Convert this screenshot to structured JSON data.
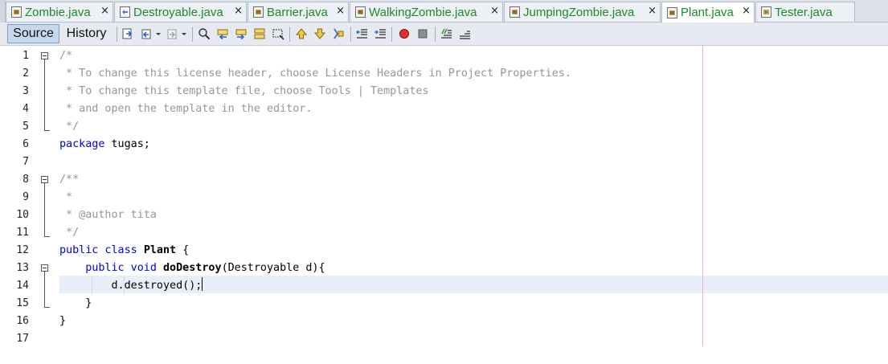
{
  "tabs": [
    {
      "label": "Zombie.java",
      "active": false
    },
    {
      "label": "Destroyable.java",
      "active": false
    },
    {
      "label": "Barrier.java",
      "active": false
    },
    {
      "label": "WalkingZombie.java",
      "active": false
    },
    {
      "label": "JumpingZombie.java",
      "active": false
    },
    {
      "label": "Plant.java",
      "active": true
    },
    {
      "label": "Tester.java",
      "active": false
    }
  ],
  "close_glyph": "×",
  "toolbar": {
    "source_label": "Source",
    "history_label": "History",
    "icons": [
      "last-edit-icon",
      "back-icon",
      "forward-icon",
      "find-icon",
      "find-previous-icon",
      "find-next-icon",
      "toggle-highlight-icon",
      "find-selection-icon",
      "previous-bookmark-icon",
      "next-bookmark-icon",
      "toggle-bookmark-icon",
      "shift-left-icon",
      "shift-right-icon",
      "start-macro-icon",
      "stop-macro-icon",
      "comment-icon",
      "uncomment-icon"
    ]
  },
  "editor": {
    "line_numbers": [
      "1",
      "2",
      "3",
      "4",
      "5",
      "6",
      "7",
      "8",
      "9",
      "10",
      "11",
      "12",
      "13",
      "14",
      "15",
      "16",
      "17"
    ],
    "current_line": 14,
    "lines": [
      {
        "n": 1,
        "tokens": [
          {
            "t": "/*",
            "c": "cmt"
          }
        ]
      },
      {
        "n": 2,
        "tokens": [
          {
            "t": " * To change this license header, choose License Headers in Project Properties.",
            "c": "cmt"
          }
        ]
      },
      {
        "n": 3,
        "tokens": [
          {
            "t": " * To change this template file, choose Tools | Templates",
            "c": "cmt"
          }
        ]
      },
      {
        "n": 4,
        "tokens": [
          {
            "t": " * and open the template in the editor.",
            "c": "cmt"
          }
        ]
      },
      {
        "n": 5,
        "tokens": [
          {
            "t": " */",
            "c": "cmt"
          }
        ]
      },
      {
        "n": 6,
        "tokens": [
          {
            "t": "package",
            "c": "kw"
          },
          {
            "t": " tugas;",
            "c": ""
          }
        ]
      },
      {
        "n": 7,
        "tokens": []
      },
      {
        "n": 8,
        "tokens": [
          {
            "t": "/**",
            "c": "cmt"
          }
        ]
      },
      {
        "n": 9,
        "tokens": [
          {
            "t": " *",
            "c": "cmt"
          }
        ]
      },
      {
        "n": 10,
        "tokens": [
          {
            "t": " * @author tita",
            "c": "cmt"
          }
        ]
      },
      {
        "n": 11,
        "tokens": [
          {
            "t": " */",
            "c": "cmt"
          }
        ]
      },
      {
        "n": 12,
        "tokens": [
          {
            "t": "public class",
            "c": "kw"
          },
          {
            "t": " ",
            "c": ""
          },
          {
            "t": "Plant",
            "c": "b"
          },
          {
            "t": " {",
            "c": ""
          }
        ]
      },
      {
        "n": 13,
        "tokens": [
          {
            "t": "    ",
            "c": ""
          },
          {
            "t": "public void",
            "c": "kw"
          },
          {
            "t": " ",
            "c": ""
          },
          {
            "t": "doDestroy",
            "c": "b"
          },
          {
            "t": "(Destroyable d){",
            "c": ""
          }
        ]
      },
      {
        "n": 14,
        "tokens": [
          {
            "t": "        d.destroyed();",
            "c": ""
          }
        ]
      },
      {
        "n": 15,
        "tokens": [
          {
            "t": "    }",
            "c": ""
          }
        ]
      },
      {
        "n": 16,
        "tokens": [
          {
            "t": "}",
            "c": ""
          }
        ]
      },
      {
        "n": 17,
        "tokens": []
      }
    ]
  },
  "colors": {
    "tab_text": "#1e8a2c",
    "keyword": "#0000e6",
    "comment": "#969696",
    "current_line": "#e9eff8",
    "right_margin": "#f0b4be"
  }
}
